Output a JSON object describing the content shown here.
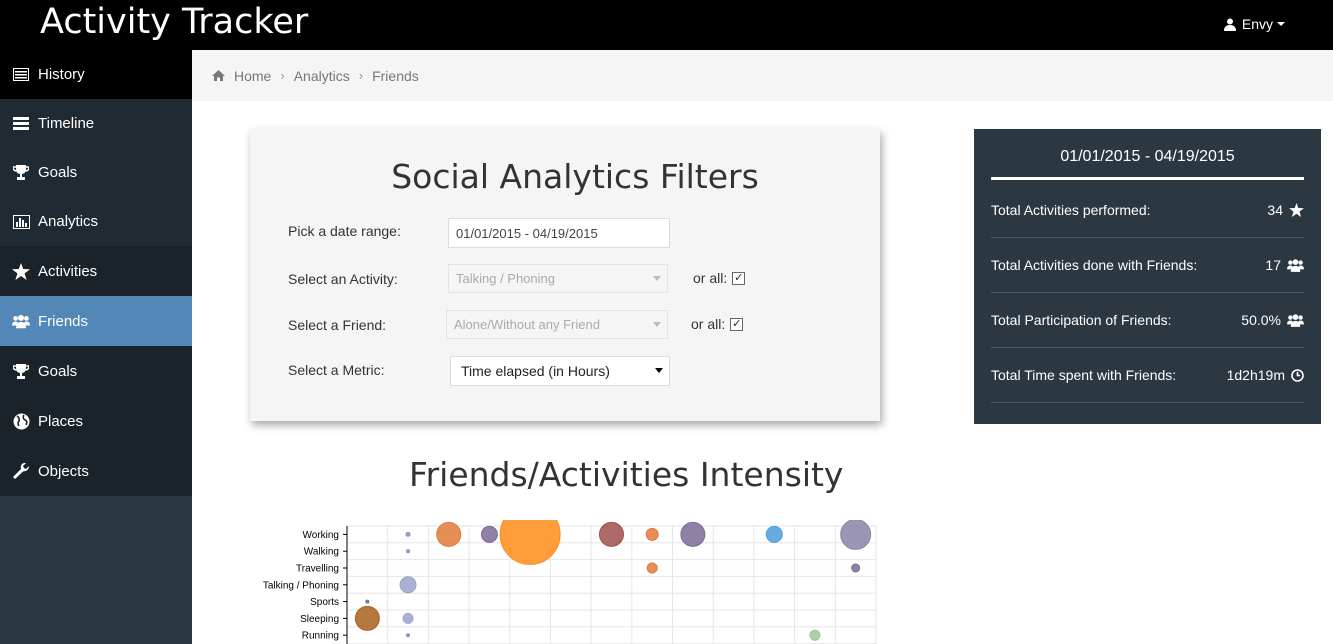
{
  "app": {
    "title": "Activity Tracker",
    "user": "Envy"
  },
  "sidebar": {
    "items": [
      {
        "label": "History",
        "icon": "list-icon"
      },
      {
        "label": "Timeline",
        "icon": "timeline-icon"
      },
      {
        "label": "Goals",
        "icon": "trophy-icon"
      },
      {
        "label": "Analytics",
        "icon": "bar-chart-icon"
      },
      {
        "label": "Activities",
        "icon": "star-icon"
      },
      {
        "label": "Friends",
        "icon": "users-icon"
      },
      {
        "label": "Goals",
        "icon": "trophy-icon"
      },
      {
        "label": "Places",
        "icon": "globe-icon"
      },
      {
        "label": "Objects",
        "icon": "wrench-icon"
      }
    ]
  },
  "breadcrumb": {
    "items": [
      "Home",
      "Analytics",
      "Friends"
    ]
  },
  "filters": {
    "title": "Social Analytics Filters",
    "date_label": "Pick a date range:",
    "date_value": "01/01/2015 - 04/19/2015",
    "activity_label": "Select an Activity:",
    "activity_value": "Talking / Phoning",
    "friend_label": "Select a Friend:",
    "friend_value": "Alone/Without any Friend",
    "metric_label": "Select a Metric:",
    "metric_value": "Time elapsed (in Hours)",
    "or_all": "or all:"
  },
  "stats": {
    "range": "01/01/2015 - 04/19/2015",
    "rows": [
      {
        "label": "Total Activities performed:",
        "value": "34",
        "icon": "star-icon"
      },
      {
        "label": "Total Activities done with Friends:",
        "value": "17",
        "icon": "users-icon"
      },
      {
        "label": "Total Participation of Friends:",
        "value": "50.0%",
        "icon": "users-icon"
      },
      {
        "label": "Total Time spent with Friends:",
        "value": "1d2h19m",
        "icon": "clock-icon"
      }
    ]
  },
  "chart_data": {
    "type": "scatter",
    "title": "Friends/Activities Intensity",
    "y_categories": [
      "Working",
      "Walking",
      "Travelling",
      "Talking / Phoning",
      "Sports",
      "Sleeping",
      "Running"
    ],
    "columns": 13,
    "points": [
      {
        "col": 1,
        "row": "Working",
        "size": 2,
        "color": "#8a90b8"
      },
      {
        "col": 2,
        "row": "Working",
        "size": 12,
        "color": "#e07b39"
      },
      {
        "col": 3,
        "row": "Working",
        "size": 8,
        "color": "#7b6b95"
      },
      {
        "col": 4,
        "row": "Working",
        "size": 30,
        "color": "#ff8c1a"
      },
      {
        "col": 6,
        "row": "Working",
        "size": 12,
        "color": "#a0504f"
      },
      {
        "col": 7,
        "row": "Working",
        "size": 6,
        "color": "#e07b39"
      },
      {
        "col": 8,
        "row": "Working",
        "size": 12,
        "color": "#7b6b95"
      },
      {
        "col": 10,
        "row": "Working",
        "size": 8,
        "color": "#4a9ee0"
      },
      {
        "col": 12,
        "row": "Working",
        "size": 15,
        "color": "#8a84a8"
      },
      {
        "col": 1,
        "row": "Walking",
        "size": 1.5,
        "color": "#8a90b8"
      },
      {
        "col": 7,
        "row": "Travelling",
        "size": 5,
        "color": "#e07b39"
      },
      {
        "col": 12,
        "row": "Travelling",
        "size": 4,
        "color": "#7b6b95"
      },
      {
        "col": 1,
        "row": "Talking / Phoning",
        "size": 8,
        "color": "#9aa5c8"
      },
      {
        "col": 0,
        "row": "Sports",
        "size": 1.5,
        "color": "#7b6b95"
      },
      {
        "col": 0,
        "row": "Sleeping",
        "size": 12,
        "color": "#a8621c"
      },
      {
        "col": 1,
        "row": "Sleeping",
        "size": 5,
        "color": "#9aa5c8"
      },
      {
        "col": 1,
        "row": "Running",
        "size": 1.5,
        "color": "#8a90b8"
      },
      {
        "col": 11,
        "row": "Running",
        "size": 5,
        "color": "#9ec79a"
      }
    ]
  }
}
